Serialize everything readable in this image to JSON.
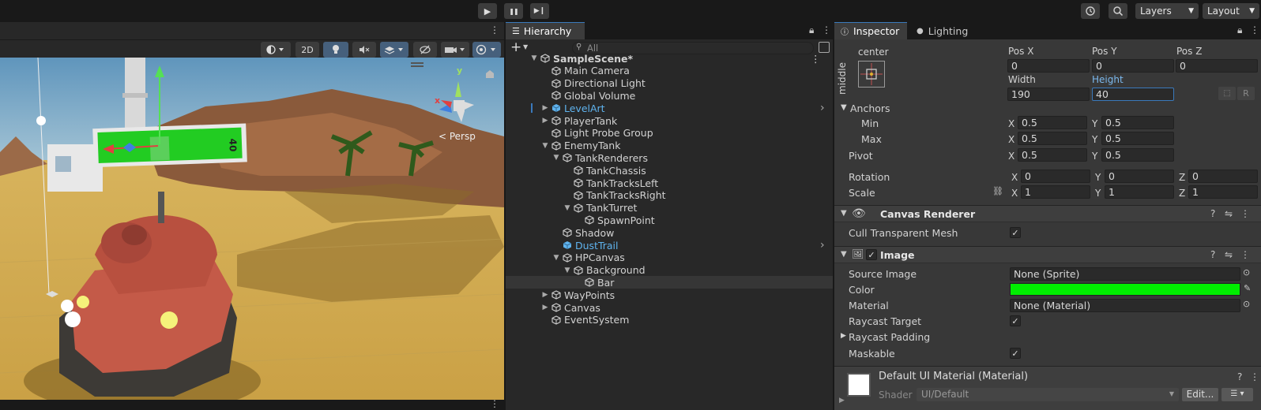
{
  "toolbar": {
    "play": "▶",
    "pause": "❚❚",
    "step": "▶❙",
    "history_icon": "history-icon",
    "search_icon": "search-icon",
    "layers_label": "Layers",
    "layout_label": "Layout"
  },
  "scene": {
    "btn_2d": "2D",
    "persp_label": "< Persp",
    "gizmo_x": "x",
    "gizmo_y": "y",
    "hp_value": "40"
  },
  "hierarchy": {
    "tab_label": "Hierarchy",
    "add_label": "+",
    "search_placeholder": "All",
    "items": [
      {
        "label": "SampleScene*"
      },
      {
        "label": "Main Camera"
      },
      {
        "label": "Directional Light"
      },
      {
        "label": "Global Volume"
      },
      {
        "label": "LevelArt"
      },
      {
        "label": "PlayerTank"
      },
      {
        "label": "Light Probe Group"
      },
      {
        "label": "EnemyTank"
      },
      {
        "label": "TankRenderers"
      },
      {
        "label": "TankChassis"
      },
      {
        "label": "TankTracksLeft"
      },
      {
        "label": "TankTracksRight"
      },
      {
        "label": "TankTurret"
      },
      {
        "label": "SpawnPoint"
      },
      {
        "label": "Shadow"
      },
      {
        "label": "DustTrail"
      },
      {
        "label": "HPCanvas"
      },
      {
        "label": "Background"
      },
      {
        "label": "Bar"
      },
      {
        "label": "WayPoints"
      },
      {
        "label": "Canvas"
      },
      {
        "label": "EventSystem"
      }
    ]
  },
  "inspector": {
    "tab_inspector": "Inspector",
    "tab_lighting": "Lighting",
    "anchor_h": "center",
    "anchor_v": "middle",
    "pos_x_label": "Pos X",
    "pos_y_label": "Pos Y",
    "pos_z_label": "Pos Z",
    "pos_x": "0",
    "pos_y": "0",
    "pos_z": "0",
    "width_label": "Width",
    "height_label": "Height",
    "width": "190",
    "height": "40",
    "r_label": "R",
    "anchors_label": "Anchors",
    "min_label": "Min",
    "max_label": "Max",
    "pivot_label": "Pivot",
    "x": "X",
    "y": "Y",
    "z": "Z",
    "min_x": "0.5",
    "min_y": "0.5",
    "max_x": "0.5",
    "max_y": "0.5",
    "pivot_x": "0.5",
    "pivot_y": "0.5",
    "rotation_label": "Rotation",
    "rot_x": "0",
    "rot_y": "0",
    "rot_z": "0",
    "scale_label": "Scale",
    "scale_x": "1",
    "scale_y": "1",
    "scale_z": "1",
    "canvas_renderer_title": "Canvas Renderer",
    "cull_label": "Cull Transparent Mesh",
    "image_title": "Image",
    "source_image_label": "Source Image",
    "source_image_value": "None (Sprite)",
    "color_label": "Color",
    "color_value": "#00ee00",
    "material_label": "Material",
    "material_value": "None (Material)",
    "raycast_target_label": "Raycast Target",
    "raycast_padding_label": "Raycast Padding",
    "maskable_label": "Maskable",
    "default_material_title": "Default UI Material (Material)",
    "shader_label": "Shader",
    "shader_value": "UI/Default",
    "edit_label": "Edit...",
    "check": "✓"
  }
}
